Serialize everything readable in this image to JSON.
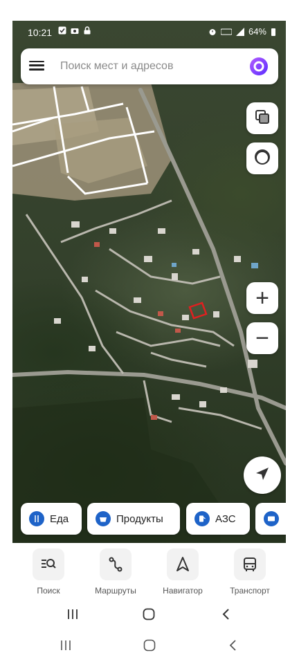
{
  "status_bar": {
    "time": "10:21",
    "battery": "64%"
  },
  "search": {
    "placeholder": "Поиск мест и адресов"
  },
  "map_controls": {
    "zoom_in": "+",
    "zoom_out": "−"
  },
  "chips": [
    {
      "label": "Еда",
      "icon": "fork-knife-icon"
    },
    {
      "label": "Продукты",
      "icon": "basket-icon"
    },
    {
      "label": "АЗС",
      "icon": "fuel-icon"
    },
    {
      "label": "",
      "icon": "atm-icon"
    }
  ],
  "tabs": [
    {
      "label": "Поиск",
      "icon": "search-list-icon"
    },
    {
      "label": "Маршруты",
      "icon": "route-icon"
    },
    {
      "label": "Навигатор",
      "icon": "navigator-arrow-icon"
    },
    {
      "label": "Транспорт",
      "icon": "bus-icon"
    }
  ],
  "colors": {
    "accent": "#1e63c8",
    "alice_purple": "#8a3ffc",
    "selected_plot": "#e02020"
  }
}
